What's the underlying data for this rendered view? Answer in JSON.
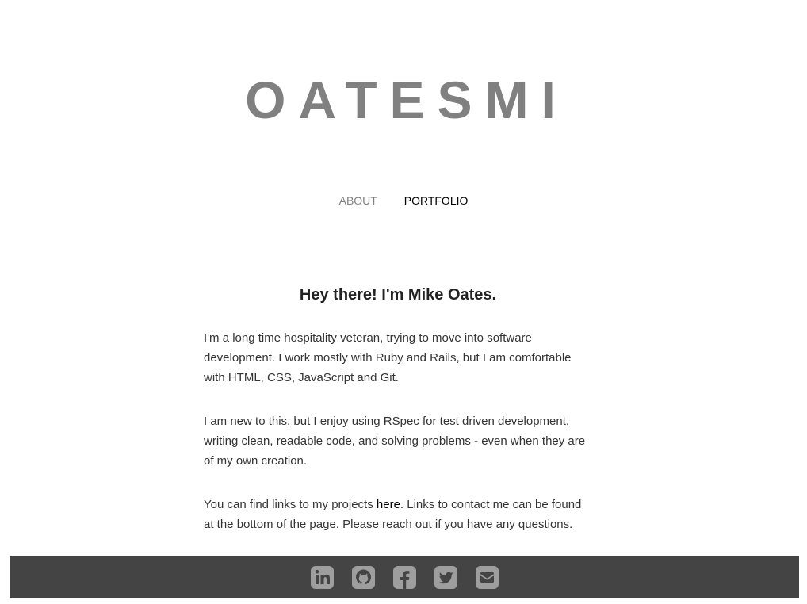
{
  "header": {
    "title": "OATESMI"
  },
  "nav": {
    "items": [
      {
        "label": "ABOUT",
        "active": false
      },
      {
        "label": "PORTFOLIO",
        "active": true
      }
    ]
  },
  "main": {
    "heading": "Hey there! I'm Mike Oates.",
    "paragraph1": "I'm a long time hospitality veteran, trying to move into software development. I work mostly with Ruby and Rails, but I am comfortable with HTML, CSS, JavaScript and Git.",
    "paragraph2": "I am new to this, but I enjoy using RSpec for test driven development, writing clean, readable code, and solving problems - even when they are of my own creation.",
    "paragraph3_before": "You can find links to my projects ",
    "paragraph3_link": "here",
    "paragraph3_after": ". Links to contact me can be found at the bottom of the page. Please reach out if you have any questions."
  },
  "footer": {
    "background": "#444444",
    "icon_color": "#9e9e9e",
    "icons": [
      "linkedin-icon",
      "github-icon",
      "facebook-icon",
      "twitter-icon",
      "email-icon"
    ]
  }
}
